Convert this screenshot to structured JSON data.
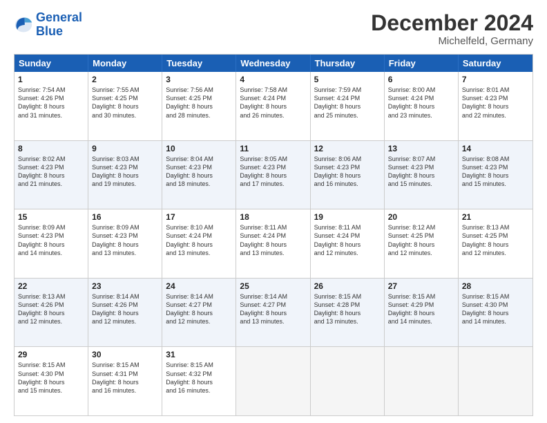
{
  "logo": {
    "text_general": "General",
    "text_blue": "Blue"
  },
  "header": {
    "title": "December 2024",
    "subtitle": "Michelfeld, Germany"
  },
  "days_of_week": [
    "Sunday",
    "Monday",
    "Tuesday",
    "Wednesday",
    "Thursday",
    "Friday",
    "Saturday"
  ],
  "weeks": [
    {
      "alt": false,
      "cells": [
        {
          "day": "1",
          "lines": [
            "Sunrise: 7:54 AM",
            "Sunset: 4:26 PM",
            "Daylight: 8 hours",
            "and 31 minutes."
          ]
        },
        {
          "day": "2",
          "lines": [
            "Sunrise: 7:55 AM",
            "Sunset: 4:25 PM",
            "Daylight: 8 hours",
            "and 30 minutes."
          ]
        },
        {
          "day": "3",
          "lines": [
            "Sunrise: 7:56 AM",
            "Sunset: 4:25 PM",
            "Daylight: 8 hours",
            "and 28 minutes."
          ]
        },
        {
          "day": "4",
          "lines": [
            "Sunrise: 7:58 AM",
            "Sunset: 4:24 PM",
            "Daylight: 8 hours",
            "and 26 minutes."
          ]
        },
        {
          "day": "5",
          "lines": [
            "Sunrise: 7:59 AM",
            "Sunset: 4:24 PM",
            "Daylight: 8 hours",
            "and 25 minutes."
          ]
        },
        {
          "day": "6",
          "lines": [
            "Sunrise: 8:00 AM",
            "Sunset: 4:24 PM",
            "Daylight: 8 hours",
            "and 23 minutes."
          ]
        },
        {
          "day": "7",
          "lines": [
            "Sunrise: 8:01 AM",
            "Sunset: 4:23 PM",
            "Daylight: 8 hours",
            "and 22 minutes."
          ]
        }
      ]
    },
    {
      "alt": true,
      "cells": [
        {
          "day": "8",
          "lines": [
            "Sunrise: 8:02 AM",
            "Sunset: 4:23 PM",
            "Daylight: 8 hours",
            "and 21 minutes."
          ]
        },
        {
          "day": "9",
          "lines": [
            "Sunrise: 8:03 AM",
            "Sunset: 4:23 PM",
            "Daylight: 8 hours",
            "and 19 minutes."
          ]
        },
        {
          "day": "10",
          "lines": [
            "Sunrise: 8:04 AM",
            "Sunset: 4:23 PM",
            "Daylight: 8 hours",
            "and 18 minutes."
          ]
        },
        {
          "day": "11",
          "lines": [
            "Sunrise: 8:05 AM",
            "Sunset: 4:23 PM",
            "Daylight: 8 hours",
            "and 17 minutes."
          ]
        },
        {
          "day": "12",
          "lines": [
            "Sunrise: 8:06 AM",
            "Sunset: 4:23 PM",
            "Daylight: 8 hours",
            "and 16 minutes."
          ]
        },
        {
          "day": "13",
          "lines": [
            "Sunrise: 8:07 AM",
            "Sunset: 4:23 PM",
            "Daylight: 8 hours",
            "and 15 minutes."
          ]
        },
        {
          "day": "14",
          "lines": [
            "Sunrise: 8:08 AM",
            "Sunset: 4:23 PM",
            "Daylight: 8 hours",
            "and 15 minutes."
          ]
        }
      ]
    },
    {
      "alt": false,
      "cells": [
        {
          "day": "15",
          "lines": [
            "Sunrise: 8:09 AM",
            "Sunset: 4:23 PM",
            "Daylight: 8 hours",
            "and 14 minutes."
          ]
        },
        {
          "day": "16",
          "lines": [
            "Sunrise: 8:09 AM",
            "Sunset: 4:23 PM",
            "Daylight: 8 hours",
            "and 13 minutes."
          ]
        },
        {
          "day": "17",
          "lines": [
            "Sunrise: 8:10 AM",
            "Sunset: 4:24 PM",
            "Daylight: 8 hours",
            "and 13 minutes."
          ]
        },
        {
          "day": "18",
          "lines": [
            "Sunrise: 8:11 AM",
            "Sunset: 4:24 PM",
            "Daylight: 8 hours",
            "and 13 minutes."
          ]
        },
        {
          "day": "19",
          "lines": [
            "Sunrise: 8:11 AM",
            "Sunset: 4:24 PM",
            "Daylight: 8 hours",
            "and 12 minutes."
          ]
        },
        {
          "day": "20",
          "lines": [
            "Sunrise: 8:12 AM",
            "Sunset: 4:25 PM",
            "Daylight: 8 hours",
            "and 12 minutes."
          ]
        },
        {
          "day": "21",
          "lines": [
            "Sunrise: 8:13 AM",
            "Sunset: 4:25 PM",
            "Daylight: 8 hours",
            "and 12 minutes."
          ]
        }
      ]
    },
    {
      "alt": true,
      "cells": [
        {
          "day": "22",
          "lines": [
            "Sunrise: 8:13 AM",
            "Sunset: 4:26 PM",
            "Daylight: 8 hours",
            "and 12 minutes."
          ]
        },
        {
          "day": "23",
          "lines": [
            "Sunrise: 8:14 AM",
            "Sunset: 4:26 PM",
            "Daylight: 8 hours",
            "and 12 minutes."
          ]
        },
        {
          "day": "24",
          "lines": [
            "Sunrise: 8:14 AM",
            "Sunset: 4:27 PM",
            "Daylight: 8 hours",
            "and 12 minutes."
          ]
        },
        {
          "day": "25",
          "lines": [
            "Sunrise: 8:14 AM",
            "Sunset: 4:27 PM",
            "Daylight: 8 hours",
            "and 13 minutes."
          ]
        },
        {
          "day": "26",
          "lines": [
            "Sunrise: 8:15 AM",
            "Sunset: 4:28 PM",
            "Daylight: 8 hours",
            "and 13 minutes."
          ]
        },
        {
          "day": "27",
          "lines": [
            "Sunrise: 8:15 AM",
            "Sunset: 4:29 PM",
            "Daylight: 8 hours",
            "and 14 minutes."
          ]
        },
        {
          "day": "28",
          "lines": [
            "Sunrise: 8:15 AM",
            "Sunset: 4:30 PM",
            "Daylight: 8 hours",
            "and 14 minutes."
          ]
        }
      ]
    },
    {
      "alt": false,
      "cells": [
        {
          "day": "29",
          "lines": [
            "Sunrise: 8:15 AM",
            "Sunset: 4:30 PM",
            "Daylight: 8 hours",
            "and 15 minutes."
          ]
        },
        {
          "day": "30",
          "lines": [
            "Sunrise: 8:15 AM",
            "Sunset: 4:31 PM",
            "Daylight: 8 hours",
            "and 16 minutes."
          ]
        },
        {
          "day": "31",
          "lines": [
            "Sunrise: 8:15 AM",
            "Sunset: 4:32 PM",
            "Daylight: 8 hours",
            "and 16 minutes."
          ]
        },
        {
          "day": "",
          "lines": []
        },
        {
          "day": "",
          "lines": []
        },
        {
          "day": "",
          "lines": []
        },
        {
          "day": "",
          "lines": []
        }
      ]
    }
  ]
}
